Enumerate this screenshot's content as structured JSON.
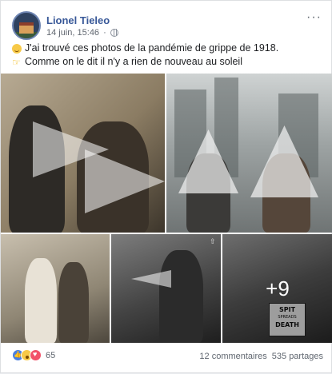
{
  "post": {
    "author": "Lionel Tieleo",
    "timestamp": "14 juin, 15:46",
    "menu_icon": "ellipsis-icon",
    "text_line_1": "J'ai trouvé ces photos de la pandémie de grippe de 1918.",
    "text_line_2": "Comme on le dit il n'y a rien de nouveau au soleil",
    "line_1_emoji": "grinning-face-emoji",
    "line_2_emoji": "backhand-index-pointing-right-emoji"
  },
  "gallery": {
    "more_count": "+9",
    "sign": {
      "line1": "SPIT",
      "line2": "SPREADS",
      "line3": "DEATH"
    }
  },
  "footer": {
    "reaction_icons": [
      "like-icon",
      "wow-icon",
      "love-icon"
    ],
    "reaction_count": "65",
    "comments": "12 commentaires",
    "shares": "535 partages"
  },
  "colors": {
    "author_link": "#385898",
    "like": "#4a7fe0",
    "love": "#f25268",
    "wow": "#f7c948"
  }
}
